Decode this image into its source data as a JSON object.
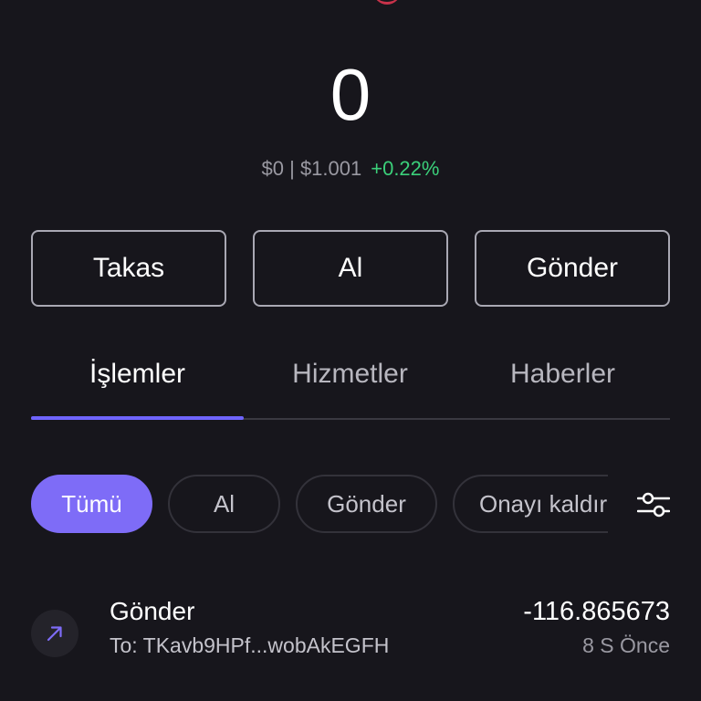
{
  "balance": {
    "amount": "0",
    "fiat": "$0 | $1.001",
    "change": "+0.22%"
  },
  "actions": {
    "swap": "Takas",
    "buy": "Al",
    "send": "Gönder"
  },
  "tabs": [
    {
      "label": "İşlemler",
      "active": true
    },
    {
      "label": "Hizmetler",
      "active": false
    },
    {
      "label": "Haberler",
      "active": false
    }
  ],
  "filters": [
    {
      "label": "Tümü",
      "active": true
    },
    {
      "label": "Al",
      "active": false
    },
    {
      "label": "Gönder",
      "active": false
    },
    {
      "label": "Onayı kaldır",
      "active": false
    }
  ],
  "transactions": [
    {
      "title": "Gönder",
      "address": "To: TKavb9HPf...wobAkEGFH",
      "amount": "-116.865673",
      "time": "8 S Önce",
      "icon": "arrow-up-right-icon"
    }
  ],
  "colors": {
    "accent": "#7e6cf7",
    "positive": "#3bd07a",
    "background": "#17161c"
  }
}
